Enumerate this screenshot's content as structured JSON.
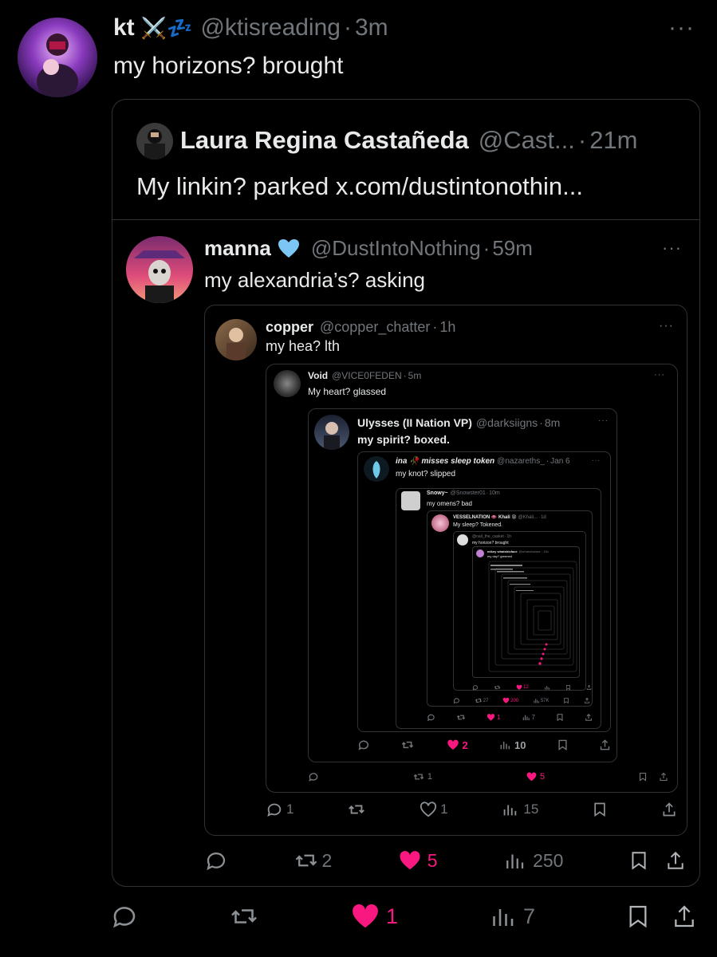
{
  "main": {
    "author": {
      "name": "kt",
      "emoji": "⚔️💤",
      "handle": "@ktisreading",
      "time": "3m"
    },
    "text": "my horizons? brought",
    "metrics": {
      "reply": "",
      "retweet": "",
      "like": "1",
      "views": "7"
    }
  },
  "q1": {
    "author": {
      "name": "Laura Regina Castañeda",
      "handle": "@Cast...",
      "time": "21m"
    },
    "text": "My linkin? parked x.com/dustintonothin...",
    "metrics": {
      "reply": "",
      "retweet": "2",
      "like": "5",
      "views": "250"
    }
  },
  "q2": {
    "author": {
      "name": "manna",
      "handle": "@DustIntoNothing",
      "time": "59m"
    },
    "text": "my alexandria’s? asking"
  },
  "q3": {
    "author": {
      "name": "copper",
      "handle": "@copper_chatter",
      "time": "1h"
    },
    "text": "my hea? lth",
    "metrics": {
      "reply": "1",
      "retweet": "",
      "like": "1",
      "views": "15"
    }
  },
  "q4": {
    "author": {
      "name": "Void",
      "handle": "@VICE0FEDEN",
      "time": "5m"
    },
    "text": "My heart? glassed",
    "metrics": {
      "reply": "",
      "retweet": "1",
      "like": "5",
      "views": ""
    }
  },
  "q5": {
    "author": {
      "name": "Ulysses (II Nation VP)",
      "handle": "@darksiigns",
      "time": "8m"
    },
    "text": "my spirit? boxed.",
    "metrics": {
      "reply": "",
      "retweet": "",
      "like": "2",
      "views": "10"
    }
  },
  "q6": {
    "author": {
      "name": "ina 🥀 misses sleep token",
      "handle": "@nazareths_",
      "time": "Jan 6"
    },
    "text": "my knot? slipped",
    "metrics": {
      "reply": "",
      "retweet": "",
      "like": "1",
      "views": "7"
    }
  },
  "q7": {
    "author": {
      "name": "Snowy~",
      "handle": "@Snowster01",
      "time": "10m"
    },
    "text": "my omens? bad",
    "metrics": {
      "reply": "",
      "retweet": "27",
      "like": "200",
      "views": "57K"
    }
  },
  "q8": {
    "author": {
      "name": "VESSELNATION 👄 Khali 😵",
      "handle": "@Khali...",
      "time": "1d"
    },
    "text": "My sleep? Tokened.",
    "metrics": {
      "reply": "",
      "retweet": "",
      "like": "12",
      "views": ""
    }
  },
  "q9": {
    "author": {
      "name": "",
      "handle": "@nail_the_casket",
      "time": "1h"
    },
    "text": "my horizon? brought"
  },
  "q10": {
    "author": {
      "name": "mikey whatshisface",
      "handle": "@whatshisface",
      "time": "10h"
    },
    "text": "my day? greened"
  },
  "colors": {
    "bg": "#000000",
    "border": "#2f3336",
    "text": "#e7e9ea",
    "muted": "#71767b",
    "like": "#f91880",
    "verified_heart": "#7cc6f5"
  }
}
